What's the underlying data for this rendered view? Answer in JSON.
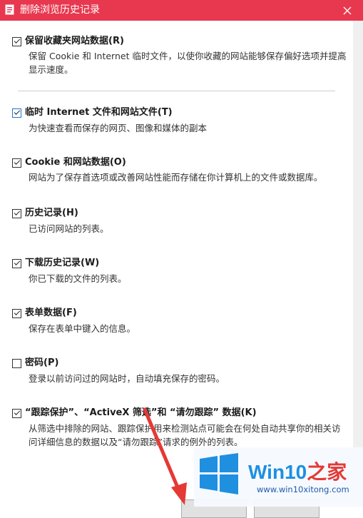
{
  "window": {
    "title": "删除浏览历史记录",
    "close_glyph": "✕"
  },
  "options": [
    {
      "title": "保留收藏夹网站数据(R)",
      "desc": "保留 Cookie 和 Internet 临时文件，以使你收藏的网站能够保存偏好选项并提高显示速度。",
      "checked": true
    },
    {
      "title": "临时 Internet 文件和网站文件(T)",
      "desc": "为快速查看而保存的网页、图像和媒体的副本",
      "checked": true
    },
    {
      "title": "Cookie 和网站数据(O)",
      "desc": "网站为了保存首选项或改善网站性能而存储在你计算机上的文件或数据库。",
      "checked": true
    },
    {
      "title": "历史记录(H)",
      "desc": "已访问网站的列表。",
      "checked": true
    },
    {
      "title": "下载历史记录(W)",
      "desc": "你已下载的文件的列表。",
      "checked": true
    },
    {
      "title": "表单数据(F)",
      "desc": "保存在表单中键入的信息。",
      "checked": true
    },
    {
      "title": "密码(P)",
      "desc": "登录以前访问过的网站时，自动填充保存的密码。",
      "checked": false
    },
    {
      "title": "“跟踪保护”、“ActiveX 筛选”和 “请勿跟踪” 数据(K)",
      "desc": "从筛选中排除的网站、跟踪保护用来检测站点可能会在何处自动共享你的相关访问详细信息的数据以及“请勿跟踪”请求的例外的列表。",
      "checked": true
    }
  ],
  "watermark": {
    "brand": "Win10",
    "brand_zh": "之家",
    "url": "www.win10xitong.com"
  },
  "colors": {
    "titlebar": "#e8384f",
    "arrow": "#e53935",
    "brand_blue": "#1f8fe0"
  },
  "icons": {
    "app": "history-delete-icon",
    "close": "close-icon",
    "logo": "windows-logo-icon"
  }
}
